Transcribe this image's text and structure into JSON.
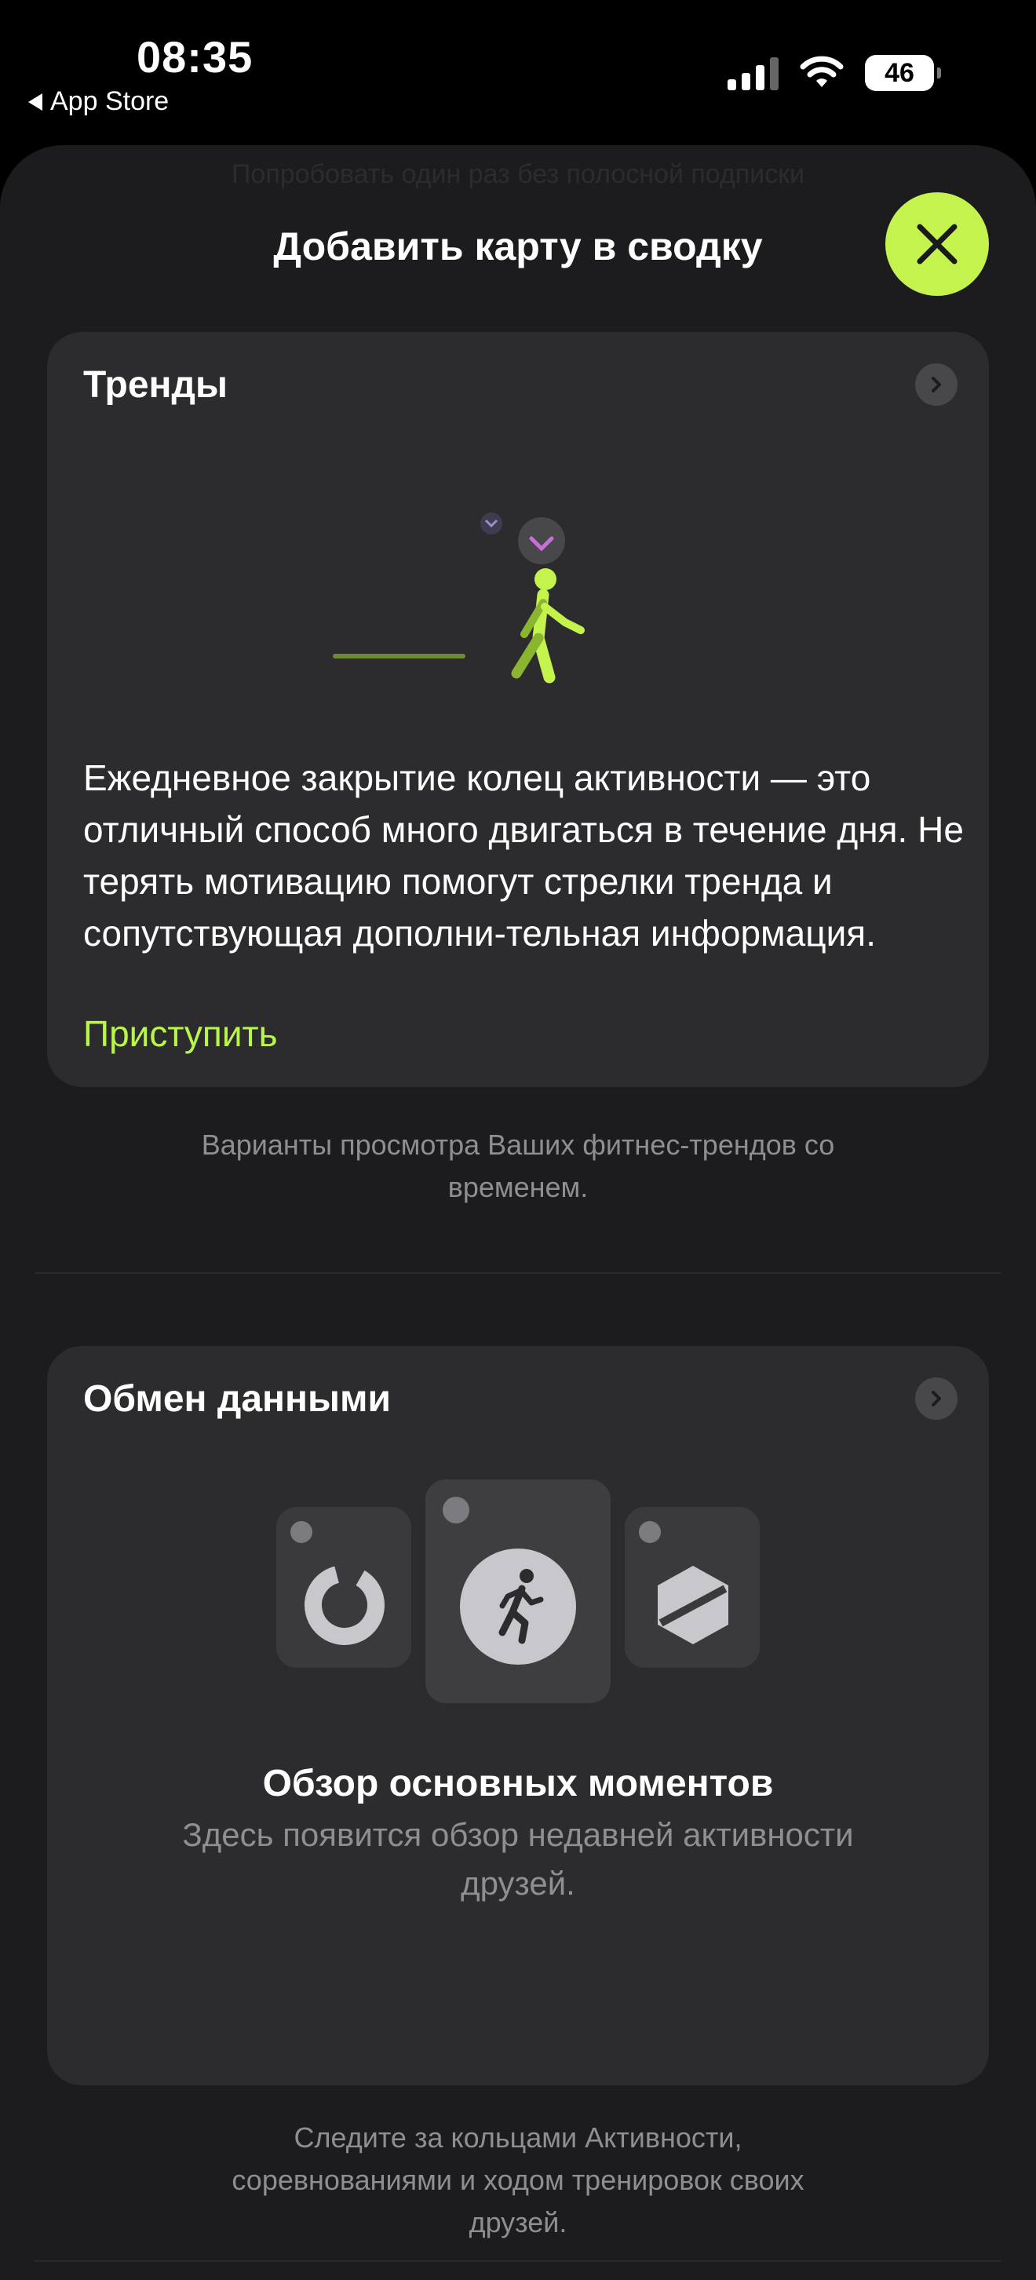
{
  "status_bar": {
    "time": "08:35",
    "back_label": "App Store",
    "battery": "46"
  },
  "sheet": {
    "ghost_text": "Попробовать один раз без полосной подписки",
    "title": "Добавить карту в сводку",
    "accent_color": "#c5f34d"
  },
  "trends_card": {
    "title": "Тренды",
    "description": "Ежедневное закрытие колец активности — это отличный способ много двигаться в течение дня. Не терять мотивацию помогут стрелки тренда и сопутствующая дополни-тельная информация.",
    "link": "Приступить",
    "caption": "Варианты просмотра Ваших фитнес-трендов со временем."
  },
  "sharing_card": {
    "title": "Обмен данными",
    "highlight_title": "Обзор основных моментов",
    "highlight_sub": "Здесь появится обзор недавней активности друзей.",
    "caption": "Следите за кольцами Активности, соревнованиями и ходом тренировок своих друзей."
  },
  "icons": [
    "chevron-right-icon",
    "close-icon",
    "walking-figure-icon",
    "activity-ring-icon",
    "running-figure-icon",
    "hexagon-icon",
    "signal-icon",
    "wifi-icon",
    "battery-icon"
  ]
}
